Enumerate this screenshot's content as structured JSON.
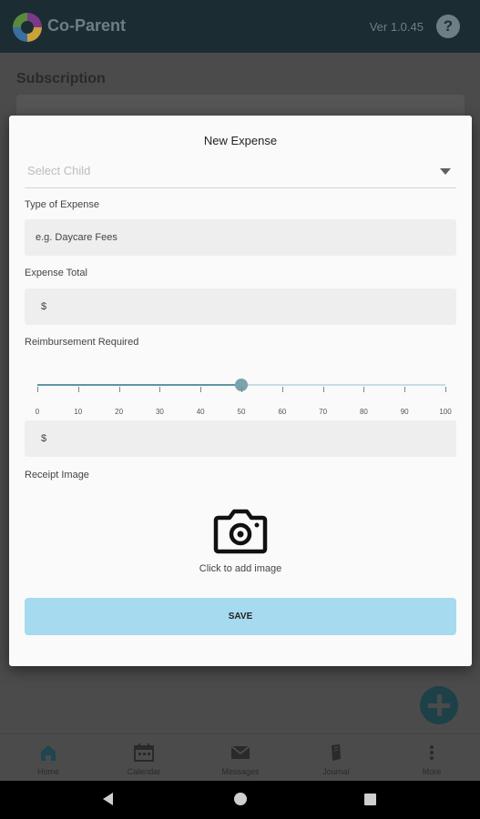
{
  "app": {
    "title": "Co-Parent",
    "version": "Ver 1.0.45",
    "help_icon": "?"
  },
  "background": {
    "heading": "Subscription"
  },
  "dialog": {
    "title": "New Expense",
    "select_child": {
      "placeholder": "Select Child"
    },
    "type_of_expense": {
      "label": "Type of Expense",
      "placeholder": "e.g. Daycare Fees"
    },
    "expense_total": {
      "label": "Expense Total",
      "prefix": "$"
    },
    "reimbursement": {
      "label": "Reimbursement Required",
      "value": 50,
      "min": 0,
      "max": 100,
      "ticks": [
        "0",
        "10",
        "20",
        "30",
        "40",
        "50",
        "60",
        "70",
        "80",
        "90",
        "100"
      ],
      "amount_prefix": "$"
    },
    "receipt": {
      "label": "Receipt Image",
      "add_text": "Click to add image",
      "icon": "camera-icon"
    },
    "save_label": "SAVE"
  },
  "bottom_nav": {
    "items": [
      {
        "label": "Home",
        "icon": "home-icon"
      },
      {
        "label": "Calendar",
        "icon": "calendar-icon"
      },
      {
        "label": "Messages",
        "icon": "mail-icon"
      },
      {
        "label": "Journal",
        "icon": "journal-icon"
      },
      {
        "label": "More",
        "icon": "more-vert-icon"
      }
    ]
  },
  "colors": {
    "accent": "#a6daef",
    "slider": "#7aa3ad",
    "appbar": "#1b2c33"
  }
}
